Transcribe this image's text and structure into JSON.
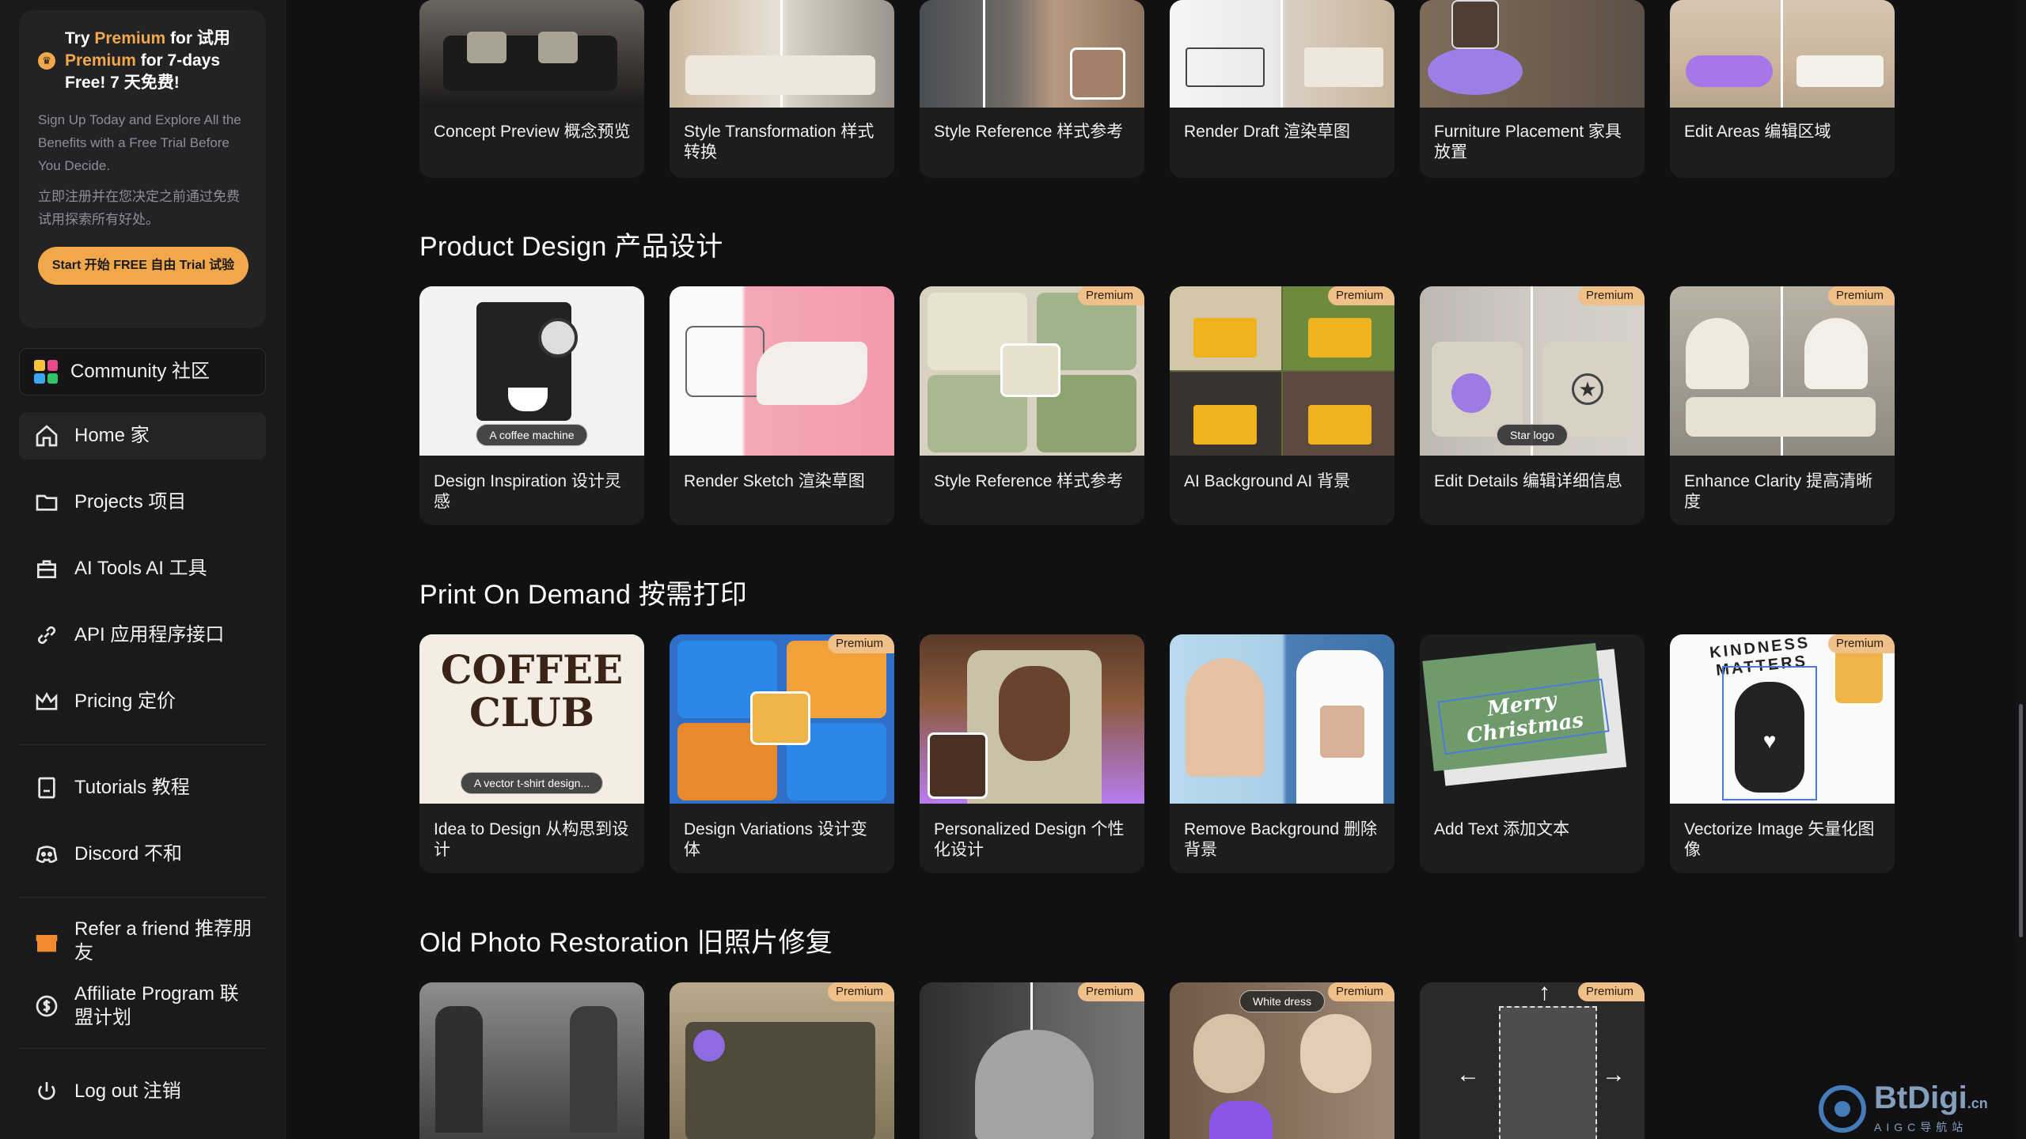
{
  "promo": {
    "title_prefix": "Try ",
    "title_accent": "Premium",
    "title_mid": " for  试用 ",
    "title_accent2": "Premium",
    "title_suffix": " for 7-days Free!  7 天免费!",
    "desc": "Sign Up Today and Explore All the Benefits with a Free Trial Before You Decide.",
    "desc_cn": "立即注册并在您决定之前通过免费试用探索所有好处。",
    "button": "Start 开始 FREE 自由 Trial 试验"
  },
  "nav": {
    "community": "Community  社区",
    "home": "Home  家",
    "projects": "Projects  项目",
    "ai_tools": "AI Tools  AI 工具",
    "api": "API  应用程序接口",
    "pricing": "Pricing  定价",
    "tutorials": "Tutorials  教程",
    "discord": "Discord  不和",
    "refer": "Refer a friend  推荐朋友",
    "affiliate": "Affiliate Program  联盟计划",
    "logout": "Log out  注销"
  },
  "sections": {
    "interior": {
      "cards": [
        {
          "label": "Concept Preview  概念预览"
        },
        {
          "label": "Style Transformation  样式转换"
        },
        {
          "label": "Style Reference  样式参考"
        },
        {
          "label": "Render Draft  渲染草图"
        },
        {
          "label": "Furniture Placement  家具放置"
        },
        {
          "label": "Edit Areas  编辑区域"
        }
      ]
    },
    "product": {
      "title": "Product Design  产品设计",
      "cards": [
        {
          "label": "Design Inspiration  设计灵感",
          "pill": "A coffee machine"
        },
        {
          "label": "Render Sketch  渲染草图"
        },
        {
          "label": "Style Reference  样式参考",
          "badge": "Premium"
        },
        {
          "label": "AI Background  AI 背景",
          "badge": "Premium"
        },
        {
          "label": "Edit Details  编辑详细信息",
          "badge": "Premium",
          "pill": "Star logo"
        },
        {
          "label": "Enhance Clarity  提高清晰度",
          "badge": "Premium"
        }
      ]
    },
    "pod": {
      "title": "Print On Demand  按需打印",
      "cards": [
        {
          "label": "Idea to Design  从构思到设计",
          "pill": "A vector t-shirt design...",
          "art": "COFFEE CLUB"
        },
        {
          "label": "Design Variations  设计变体",
          "badge": "Premium"
        },
        {
          "label": "Personalized Design  个性化设计"
        },
        {
          "label": "Remove Background  删除背景"
        },
        {
          "label": "Add Text  添加文本",
          "art": "Merry Christmas"
        },
        {
          "label": "Vectorize Image  矢量化图像",
          "badge": "Premium",
          "art": "KINDNESS MATTERS"
        }
      ]
    },
    "old_photo": {
      "title": "Old Photo Restoration  旧照片修复",
      "cards": [
        {
          "label": ""
        },
        {
          "badge": "Premium"
        },
        {
          "badge": "Premium"
        },
        {
          "badge": "Premium",
          "pill": "White dress"
        },
        {
          "badge": "Premium"
        }
      ]
    }
  },
  "watermark": {
    "name": "BtDigi",
    "tld": ".cn",
    "sub": "AIGC导航站"
  },
  "colors": {
    "accent": "#f0a84a",
    "badge": "#f0c089",
    "sidebar_bg": "#1a1a1c",
    "card_bg": "#1d1d20"
  }
}
